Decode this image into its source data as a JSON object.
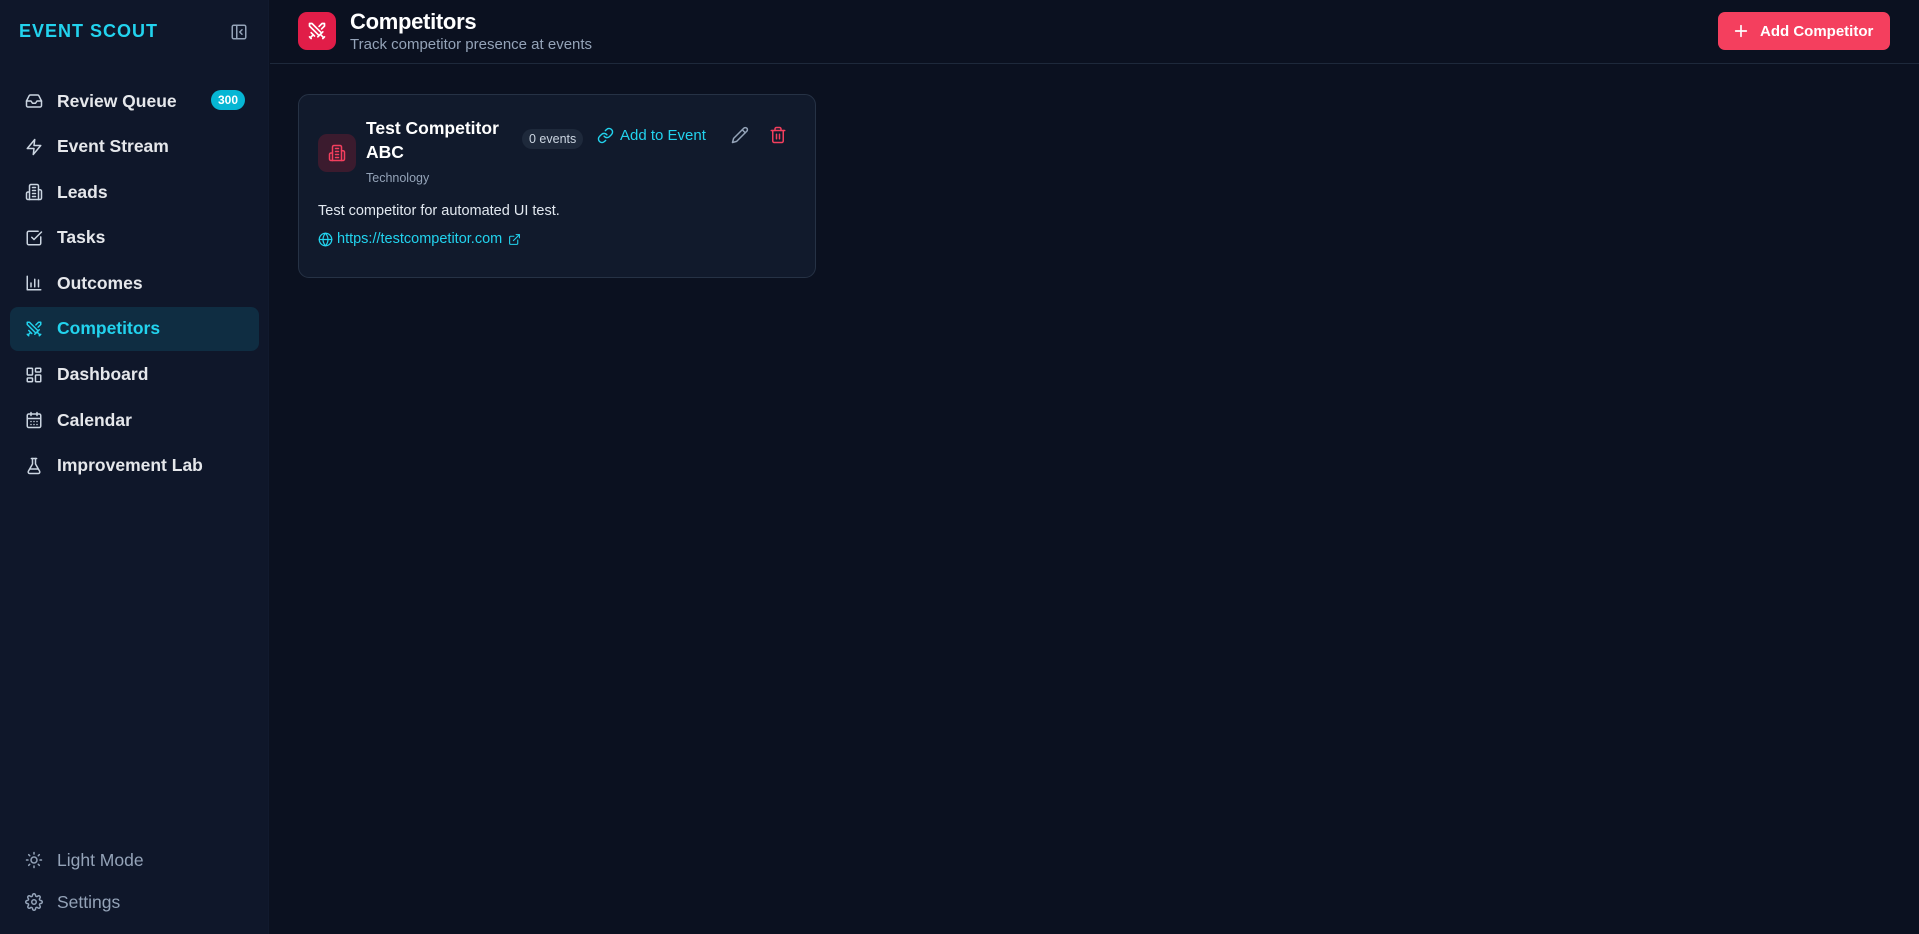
{
  "app": {
    "brand": "EVENT SCOUT"
  },
  "sidebar": {
    "items": [
      {
        "label": "Review Queue",
        "icon": "inbox-icon",
        "badge": "300"
      },
      {
        "label": "Event Stream",
        "icon": "zap-icon"
      },
      {
        "label": "Leads",
        "icon": "building-icon"
      },
      {
        "label": "Tasks",
        "icon": "check-square-icon"
      },
      {
        "label": "Outcomes",
        "icon": "bar-chart-icon"
      },
      {
        "label": "Competitors",
        "icon": "swords-icon",
        "active": true
      },
      {
        "label": "Dashboard",
        "icon": "layout-dashboard-icon"
      },
      {
        "label": "Calendar",
        "icon": "calendar-icon"
      },
      {
        "label": "Improvement Lab",
        "icon": "flask-icon"
      }
    ],
    "bottom": [
      {
        "label": "Light Mode",
        "icon": "sun-icon"
      },
      {
        "label": "Settings",
        "icon": "gear-icon"
      }
    ]
  },
  "header": {
    "title": "Competitors",
    "subtitle": "Track competitor presence at events",
    "add_label": "Add Competitor"
  },
  "competitors": [
    {
      "name": "Test Competitor ABC",
      "category": "Technology",
      "events_count": "0 events",
      "add_to_event_label": "Add to Event",
      "description": "Test competitor for automated UI test.",
      "website": "https://testcompetitor.com"
    }
  ],
  "colors": {
    "accent": "#22d3ee",
    "brand_red": "#f43f5e",
    "background": "#0b1120",
    "sidebar": "#0f172a"
  }
}
